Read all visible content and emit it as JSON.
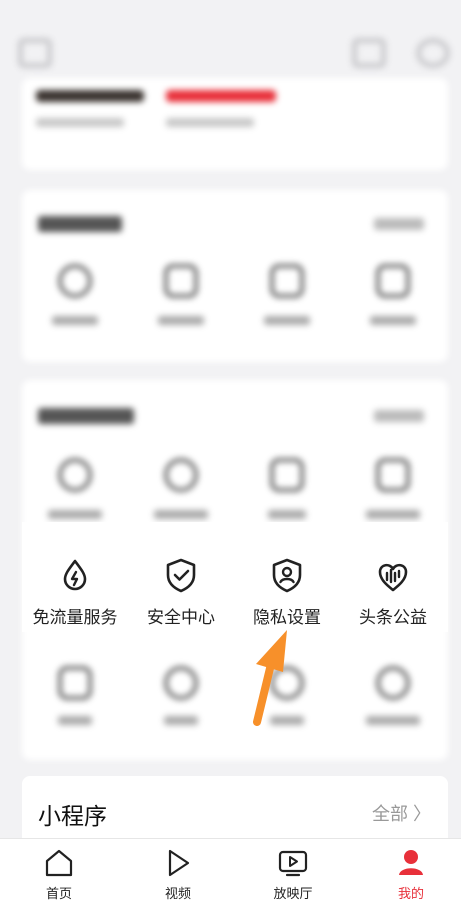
{
  "services": [
    {
      "label": "免流量服务",
      "icon": "water-drop-icon"
    },
    {
      "label": "安全中心",
      "icon": "shield-check-icon"
    },
    {
      "label": "隐私设置",
      "icon": "shield-user-icon"
    },
    {
      "label": "头条公益",
      "icon": "heart-chart-icon"
    }
  ],
  "mini_program": {
    "title": "小程序",
    "more": "全部 〉"
  },
  "bottom_nav": [
    {
      "label": "首页",
      "icon": "home-icon",
      "active": false
    },
    {
      "label": "视频",
      "icon": "play-icon",
      "active": false
    },
    {
      "label": "放映厅",
      "icon": "tv-play-icon",
      "active": false
    },
    {
      "label": "我的",
      "icon": "user-avatar-icon",
      "active": true
    }
  ],
  "colors": {
    "accent_red": "#e8303a",
    "arrow_orange": "#f7902a"
  }
}
